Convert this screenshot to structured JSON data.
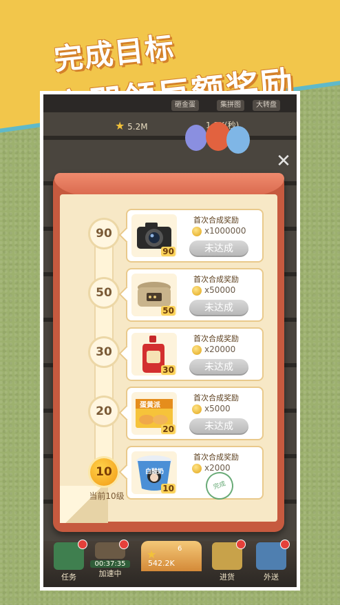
{
  "headline": {
    "line1": "完成目标",
    "line2": "立即领巨额奖励"
  },
  "top_buttons": [
    "砸金蛋",
    "集拼图",
    "大转盘"
  ],
  "stats": {
    "stars": "5.2M",
    "partial": "1.3K(秒)"
  },
  "close_symbol": "✕",
  "progress": {
    "levels": [
      "90",
      "50",
      "30",
      "20",
      "10"
    ],
    "current": "10",
    "current_label": "当前10级"
  },
  "rewards": [
    {
      "title": "首次合成奖励",
      "amount": "x1000000",
      "level": "90",
      "status": "未达成"
    },
    {
      "title": "首次合成奖励",
      "amount": "x50000",
      "level": "50",
      "status": "未达成"
    },
    {
      "title": "首次合成奖励",
      "amount": "x20000",
      "level": "30",
      "status": "未达成"
    },
    {
      "title": "首次合成奖励",
      "amount": "x5000",
      "level": "20",
      "status": "未达成"
    },
    {
      "title": "首次合成奖励",
      "amount": "x2000",
      "level": "10",
      "status": "完成"
    }
  ],
  "product_text": {
    "puff": "蛋黄派",
    "drink": "白酸奶"
  },
  "nav": {
    "task": "任务",
    "timer": "00:37:35",
    "speed": "加速中",
    "center_value": "542.2K",
    "center_count": "6",
    "stock": "进货",
    "delivery": "外送"
  },
  "colors": {
    "banner": "#f2c64b",
    "envelope": "#c65a3f",
    "paper": "#f7e8c6"
  }
}
